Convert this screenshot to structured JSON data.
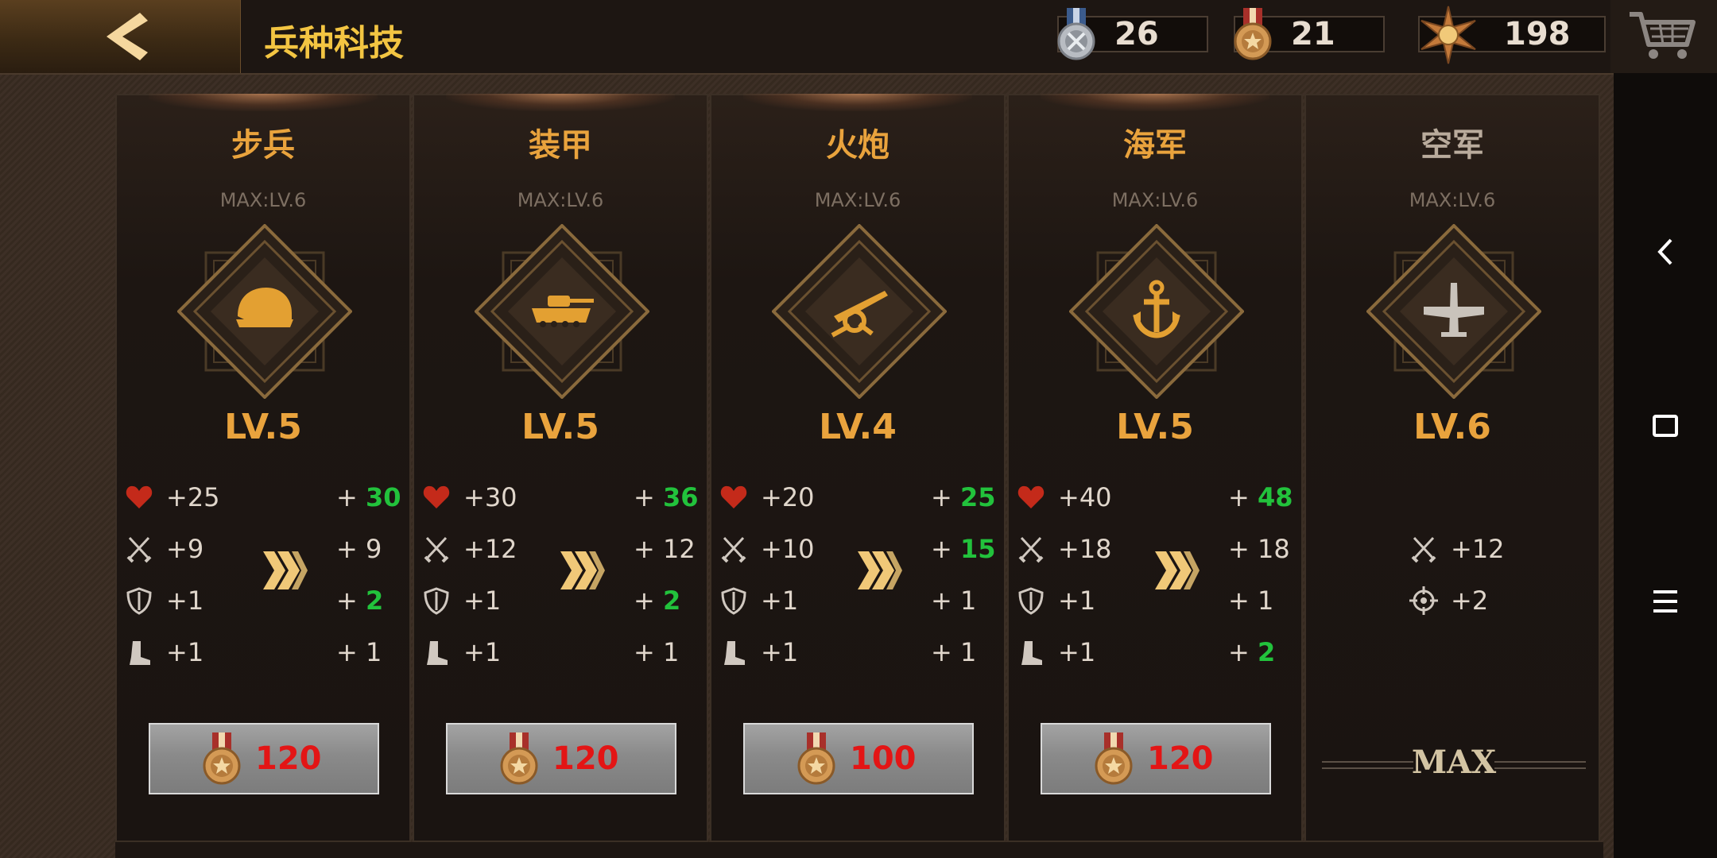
{
  "header": {
    "title": "兵种科技",
    "resources": [
      {
        "icon": "silver-medal-icon",
        "value": "26"
      },
      {
        "icon": "bronze-medal-icon",
        "value": "21"
      },
      {
        "icon": "star-badge-icon",
        "value": "198"
      }
    ]
  },
  "cards": [
    {
      "name": "步兵",
      "max": "MAX:LV.6",
      "level": "LV.5",
      "emblem": "helmet-icon",
      "stats": [
        {
          "icon": "heart-icon",
          "cur": "25",
          "next": "30",
          "up": true
        },
        {
          "icon": "crossed-swords-icon",
          "cur": "9",
          "next": "9",
          "up": false
        },
        {
          "icon": "shield-icon",
          "cur": "1",
          "next": "2",
          "up": true
        },
        {
          "icon": "boot-icon",
          "cur": "1",
          "next": "1",
          "up": false
        }
      ],
      "cost": "120"
    },
    {
      "name": "装甲",
      "max": "MAX:LV.6",
      "level": "LV.5",
      "emblem": "tank-icon",
      "stats": [
        {
          "icon": "heart-icon",
          "cur": "30",
          "next": "36",
          "up": true
        },
        {
          "icon": "crossed-swords-icon",
          "cur": "12",
          "next": "12",
          "up": false
        },
        {
          "icon": "shield-icon",
          "cur": "1",
          "next": "2",
          "up": true
        },
        {
          "icon": "boot-icon",
          "cur": "1",
          "next": "1",
          "up": false
        }
      ],
      "cost": "120"
    },
    {
      "name": "火炮",
      "max": "MAX:LV.6",
      "level": "LV.4",
      "emblem": "cannon-icon",
      "stats": [
        {
          "icon": "heart-icon",
          "cur": "20",
          "next": "25",
          "up": true
        },
        {
          "icon": "crossed-swords-icon",
          "cur": "10",
          "next": "15",
          "up": true
        },
        {
          "icon": "shield-icon",
          "cur": "1",
          "next": "1",
          "up": false
        },
        {
          "icon": "boot-icon",
          "cur": "1",
          "next": "1",
          "up": false
        }
      ],
      "cost": "100"
    },
    {
      "name": "海军",
      "max": "MAX:LV.6",
      "level": "LV.5",
      "emblem": "anchor-icon",
      "stats": [
        {
          "icon": "heart-icon",
          "cur": "40",
          "next": "48",
          "up": true
        },
        {
          "icon": "crossed-swords-icon",
          "cur": "18",
          "next": "18",
          "up": false
        },
        {
          "icon": "shield-icon",
          "cur": "1",
          "next": "1",
          "up": false
        },
        {
          "icon": "boot-icon",
          "cur": "1",
          "next": "2",
          "up": true
        }
      ],
      "cost": "120"
    },
    {
      "name": "空军",
      "max": "MAX:LV.6",
      "level": "LV.6",
      "emblem": "airplane-icon",
      "stats": [
        {
          "icon": "crossed-swords-icon",
          "cur": "12"
        },
        {
          "icon": "crosshair-icon",
          "cur": "2"
        }
      ],
      "max_label": "MAX"
    }
  ],
  "colors": {
    "accent": "#e9a33d",
    "title": "#f3c542",
    "increase": "#22c23c",
    "cost": "#e31515"
  }
}
